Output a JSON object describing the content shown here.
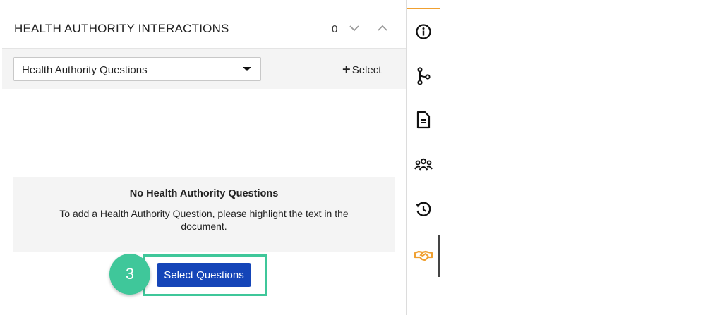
{
  "panel": {
    "title": "HEALTH AUTHORITY INTERACTIONS",
    "count": "0"
  },
  "filter": {
    "selected": "Health Authority Questions",
    "add_label": "Select"
  },
  "empty_state": {
    "title": "No Health Authority Questions",
    "description": "To add a Health Authority Question, please highlight the text in the document."
  },
  "actions": {
    "select_questions_label": "Select Questions"
  },
  "callout": {
    "step_number": "3"
  },
  "sidebar": {
    "icons": [
      "info-icon",
      "workflow-branch-icon",
      "document-icon",
      "group-icon",
      "history-icon",
      "handshake-icon"
    ],
    "active": "handshake-icon"
  },
  "colors": {
    "accent": "#f0a030",
    "primary_button": "#1545b8",
    "callout": "#3fc79a",
    "active_icon": "#f0a030"
  }
}
